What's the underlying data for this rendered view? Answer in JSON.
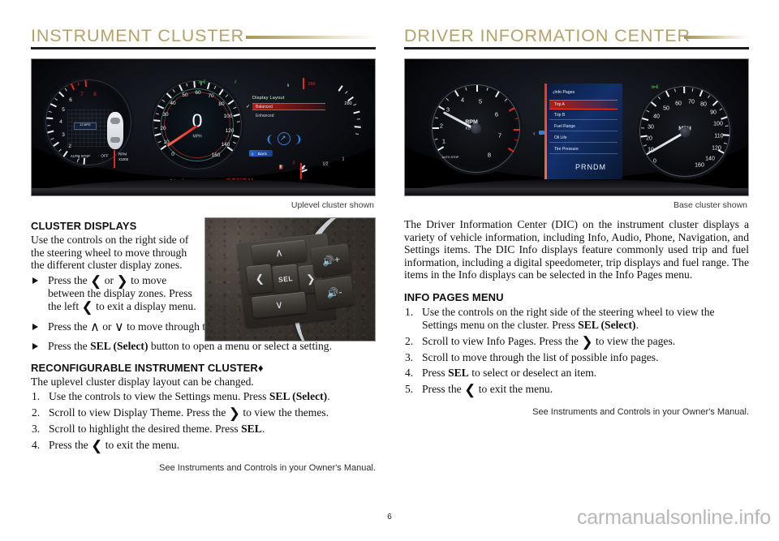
{
  "page": {
    "number": "6",
    "watermark": "carmanualsonline.info"
  },
  "left_column": {
    "section_title": "INSTRUMENT CLUSTER",
    "photo_caption": "Uplevel cluster shown",
    "cluster_photo": {
      "alt_name": "uplevel-instrument-cluster",
      "speedometer": {
        "unit": "MPH",
        "digital_readout": "0",
        "ticks": [
          "0",
          "10",
          "20",
          "30",
          "40",
          "50",
          "60",
          "70",
          "80",
          "100",
          "120",
          "140",
          "160"
        ]
      },
      "tachometer": {
        "label_line1": "RPM",
        "label_line2": "X1000",
        "ticks": [
          "1",
          "2",
          "3",
          "4",
          "5",
          "6",
          "7",
          "8"
        ],
        "auto_stop": "AUTO STOP",
        "off": "OFF"
      },
      "odometer": "21 mi",
      "gear_indicator": "PRNDM",
      "dic_menu": {
        "title": "Display Layout",
        "items": [
          {
            "label": "Balanced",
            "selected": true,
            "checked": true
          },
          {
            "label": "Enhanced",
            "selected": false,
            "checked": false
          }
        ],
        "back_button": "Back"
      },
      "right_gauge_labels": [
        "260",
        "280",
        "1",
        "1/2"
      ]
    },
    "cluster_displays": {
      "heading": "CLUSTER DISPLAYS",
      "intro": "Use the controls on the right side of the steering wheel to move through the different cluster display zones.",
      "bullets": [
        "Press the ‹ or › to move between the display zones. Press the left ‹ to exit a display menu.",
        "Press the ∧ or ∨ to move through the menus.",
        "Press the SEL (Select) button to open a menu or select a setting."
      ]
    },
    "wheel_photo": {
      "alt_name": "steering-wheel-controls",
      "buttons": {
        "select": "SEL",
        "up": "up-chevron",
        "down": "down-chevron",
        "left": "left-chevron",
        "right": "right-chevron",
        "volume_up": "volume-up",
        "volume_down": "volume-down"
      }
    },
    "reconfigurable": {
      "heading": "RECONFIGURABLE INSTRUMENT CLUSTER",
      "heading_marker": "♦",
      "intro": "The uplevel cluster display layout can be changed.",
      "steps": [
        "Use the controls to view the Settings menu. Press SEL (Select).",
        "Scroll to view Display Theme. Press the › to view the themes.",
        "Scroll to highlight the desired theme. Press SEL.",
        "Press the ‹ to exit the menu."
      ]
    },
    "footer_note": "See Instruments and Controls in your Owner's Manual."
  },
  "right_column": {
    "section_title": "DRIVER INFORMATION CENTER",
    "photo_caption": "Base cluster shown",
    "cluster_photo": {
      "alt_name": "base-instrument-cluster",
      "tachometer": {
        "label_line1": "RPM",
        "label_line2": "x1000",
        "ticks": [
          "1",
          "2",
          "3",
          "4",
          "5",
          "6",
          "7",
          "8"
        ],
        "auto_stop": "AUTO STOP"
      },
      "speedometer": {
        "unit": "MPH",
        "ticks": [
          "0",
          "10",
          "20",
          "30",
          "40",
          "50",
          "60",
          "70",
          "80",
          "90",
          "100",
          "110",
          "120",
          "140",
          "160"
        ]
      },
      "gear_indicator": "PRNDM",
      "dic_menu": {
        "title": "Info Pages",
        "items": [
          {
            "label": "Trip A",
            "highlighted": true
          },
          {
            "label": "Trip B",
            "highlighted": false
          },
          {
            "label": "Fuel Range",
            "highlighted": false
          },
          {
            "label": "Oil Life",
            "highlighted": false
          },
          {
            "label": "Tire Pressure",
            "highlighted": false
          }
        ]
      }
    },
    "intro_paragraph": "The Driver Information Center (DIC) on the instrument cluster displays a variety of vehicle information, including Info, Audio, Phone, Navigation, and Settings items. The DIC Info displays feature commonly used trip and fuel information, including a digital speedometer, trip displays and fuel range. The items in the Info displays can be selected in the Info Pages menu.",
    "info_pages": {
      "heading": "INFO PAGES MENU",
      "steps": [
        "Use the controls on the right side of the steering wheel to view the Settings menu on the cluster. Press SEL (Select).",
        "Scroll to view Info Pages. Press the › to view the pages.",
        "Scroll to move through the list of possible info pages.",
        "Press SEL to select or deselect an item.",
        "Press the ‹ to exit the menu."
      ]
    },
    "footer_note": "See Instruments and Controls in your Owner's Manual."
  },
  "colors": {
    "header_gold": "#b3a36a",
    "rule_dark": "#1c1c1c",
    "body_text": "#111111",
    "dic_red": "#e2291f",
    "dic_blue": "#2f7fd8"
  }
}
